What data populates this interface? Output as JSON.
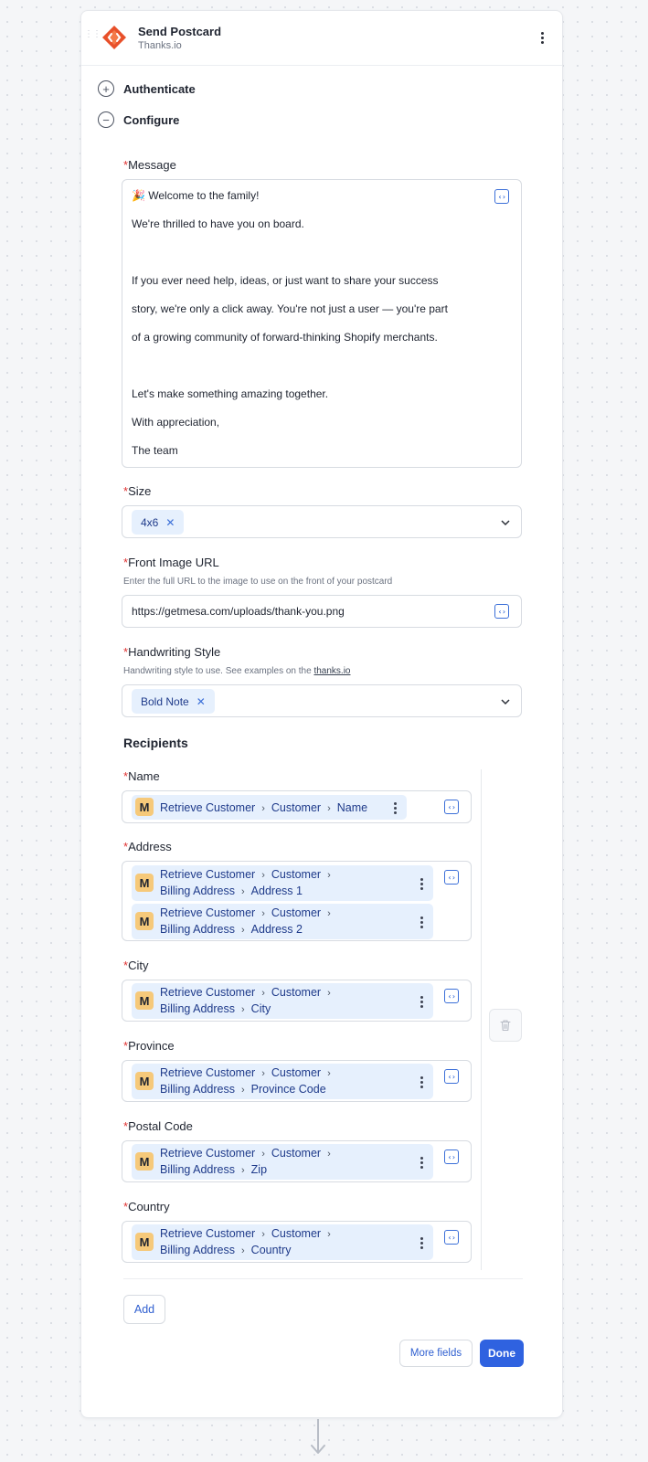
{
  "step": {
    "title": "Send Postcard",
    "app_name": "Thanks.io",
    "brand_color": "#e8502a"
  },
  "sections": {
    "authenticate": {
      "label": "Authenticate",
      "icon": "plus-circle-icon"
    },
    "configure": {
      "label": "Configure",
      "icon": "minus-circle-icon"
    }
  },
  "required_marker": "*",
  "message": {
    "label": "Message",
    "lines": [
      "🎉 Welcome to the family!",
      "We're thrilled to have you on board.",
      "If you ever need help, ideas, or just want to share your success",
      "story, we're only a click away. You're not just a user — you're part",
      "of a growing community of forward-thinking Shopify merchants.",
      "Let's make something amazing together.",
      "With appreciation,",
      "The  team"
    ]
  },
  "size": {
    "label": "Size",
    "selected": "4x6"
  },
  "front_image": {
    "label": "Front Image URL",
    "help": "Enter the full URL to the image to use on the front of your postcard",
    "value": "https://getmesa.com/uploads/thank-you.png"
  },
  "handwriting": {
    "label": "Handwriting Style",
    "help_prefix": "Handwriting style to use. See examples on the ",
    "help_link": "thanks.io",
    "selected": "Bold Note"
  },
  "recipients": {
    "title": "Recipients",
    "badge": "M",
    "fields": {
      "name": {
        "label": "Name",
        "path": [
          "Retrieve Customer",
          "Customer",
          "Name"
        ]
      },
      "address": {
        "label": "Address",
        "paths": [
          {
            "line1": [
              "Retrieve Customer",
              "Customer"
            ],
            "line2": [
              "Billing Address",
              "Address 1"
            ]
          },
          {
            "line1": [
              "Retrieve Customer",
              "Customer"
            ],
            "line2": [
              "Billing Address",
              "Address 2"
            ]
          }
        ]
      },
      "city": {
        "label": "City",
        "line1": [
          "Retrieve Customer",
          "Customer"
        ],
        "line2": [
          "Billing Address",
          "City"
        ]
      },
      "province": {
        "label": "Province",
        "line1": [
          "Retrieve Customer",
          "Customer"
        ],
        "line2": [
          "Billing Address",
          "Province Code"
        ]
      },
      "postal": {
        "label": "Postal Code",
        "line1": [
          "Retrieve Customer",
          "Customer"
        ],
        "line2": [
          "Billing Address",
          "Zip"
        ]
      },
      "country": {
        "label": "Country",
        "line1": [
          "Retrieve Customer",
          "Customer"
        ],
        "line2": [
          "Billing Address",
          "Country"
        ]
      }
    }
  },
  "buttons": {
    "add": "Add",
    "more_fields": "More fields",
    "done": "Done"
  },
  "code_icon_glyph": "‹›",
  "remove_glyph": "✕",
  "path_separator": "›",
  "colors": {
    "accent": "#2f62e0",
    "chip_bg": "#e6f0fd",
    "chip_text": "#1e3a8a",
    "badge_bg": "#f6c97a",
    "required": "#e03131"
  }
}
